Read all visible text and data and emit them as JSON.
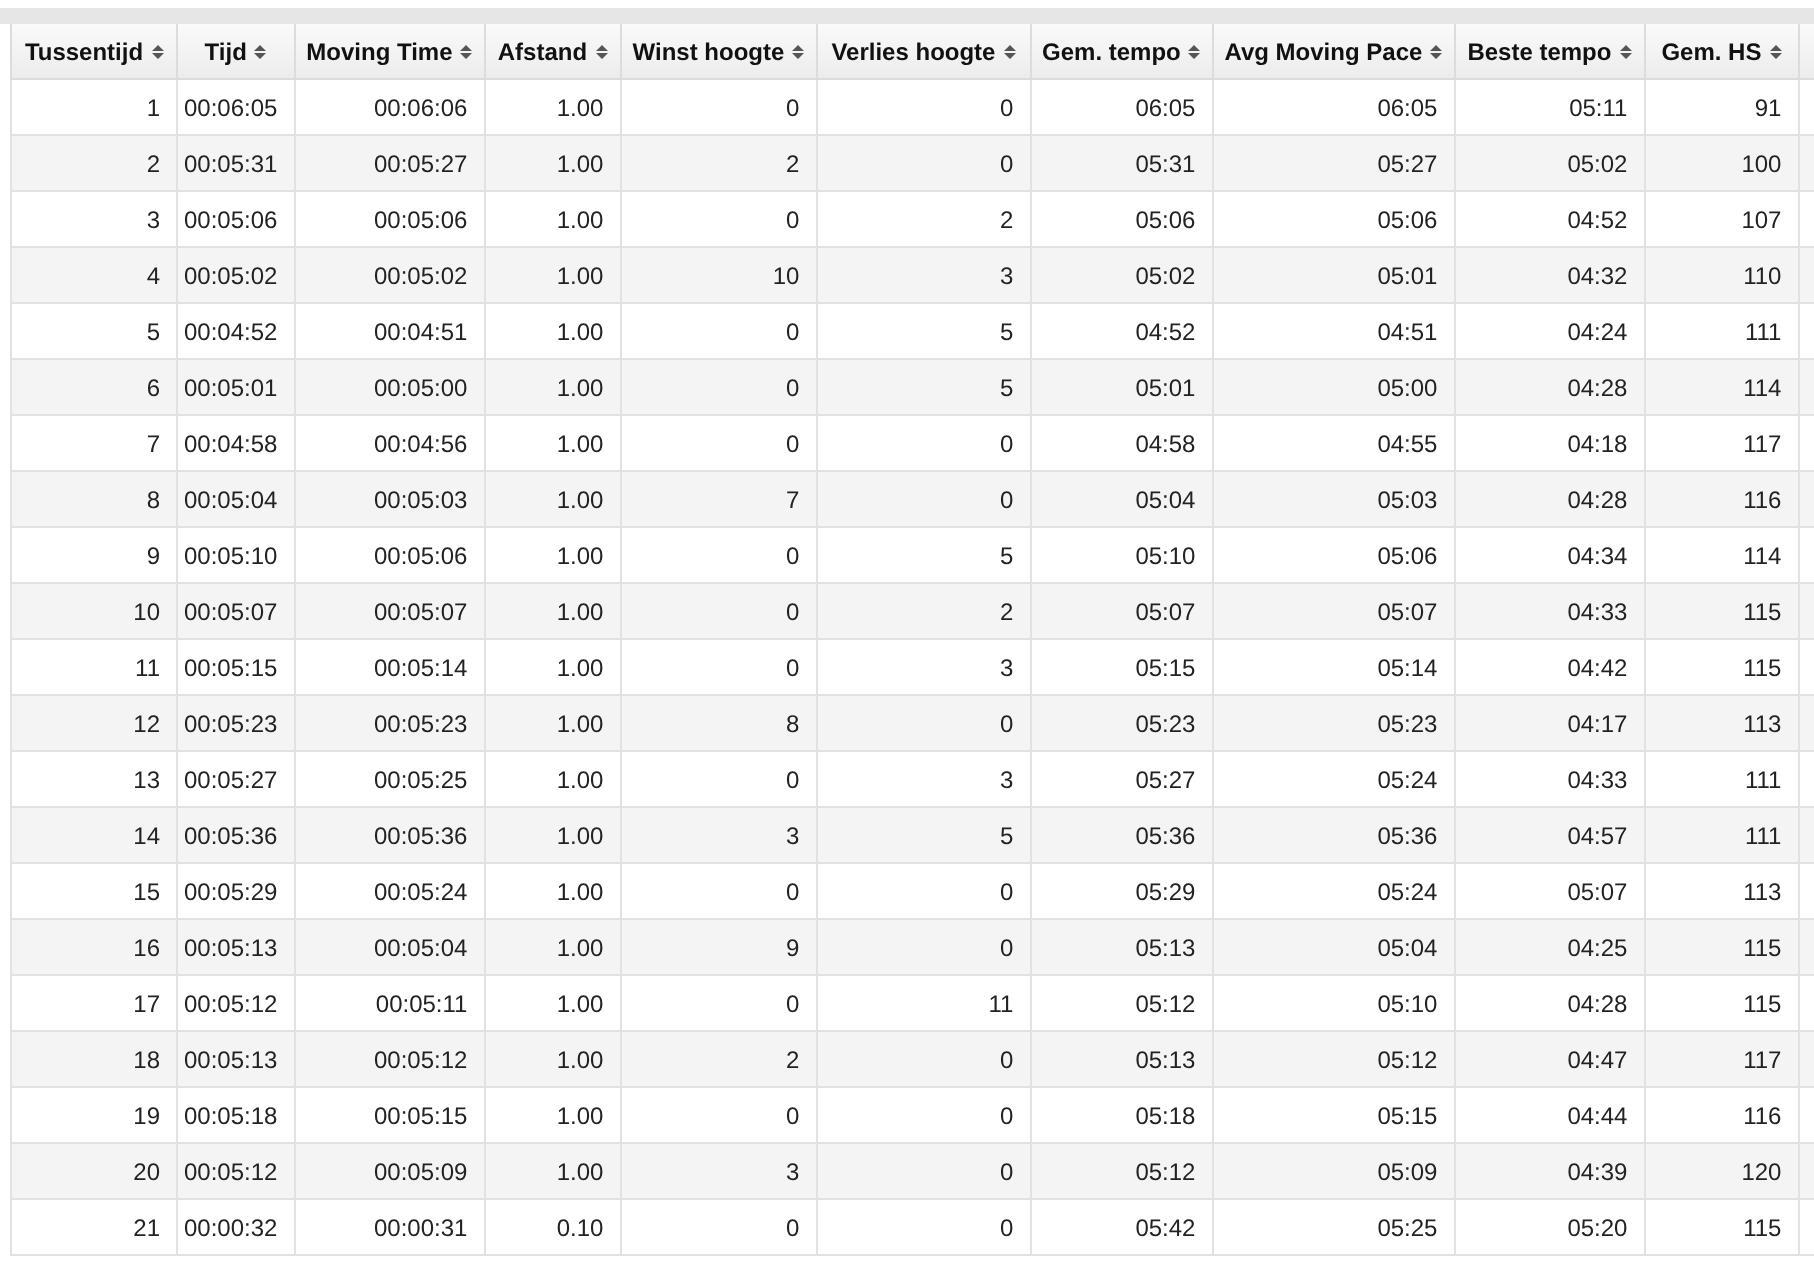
{
  "table": {
    "columns": [
      "Tussentijd",
      "Tijd",
      "Moving Time",
      "Afstand",
      "Winst hoogte",
      "Verlies hoogte",
      "Gem. tempo",
      "Avg Moving Pace",
      "Beste tempo",
      "Gem. HS"
    ],
    "rows": [
      [
        "1",
        "00:06:05",
        "00:06:06",
        "1.00",
        "0",
        "0",
        "06:05",
        "06:05",
        "05:11",
        "91"
      ],
      [
        "2",
        "00:05:31",
        "00:05:27",
        "1.00",
        "2",
        "0",
        "05:31",
        "05:27",
        "05:02",
        "100"
      ],
      [
        "3",
        "00:05:06",
        "00:05:06",
        "1.00",
        "0",
        "2",
        "05:06",
        "05:06",
        "04:52",
        "107"
      ],
      [
        "4",
        "00:05:02",
        "00:05:02",
        "1.00",
        "10",
        "3",
        "05:02",
        "05:01",
        "04:32",
        "110"
      ],
      [
        "5",
        "00:04:52",
        "00:04:51",
        "1.00",
        "0",
        "5",
        "04:52",
        "04:51",
        "04:24",
        "111"
      ],
      [
        "6",
        "00:05:01",
        "00:05:00",
        "1.00",
        "0",
        "5",
        "05:01",
        "05:00",
        "04:28",
        "114"
      ],
      [
        "7",
        "00:04:58",
        "00:04:56",
        "1.00",
        "0",
        "0",
        "04:58",
        "04:55",
        "04:18",
        "117"
      ],
      [
        "8",
        "00:05:04",
        "00:05:03",
        "1.00",
        "7",
        "0",
        "05:04",
        "05:03",
        "04:28",
        "116"
      ],
      [
        "9",
        "00:05:10",
        "00:05:06",
        "1.00",
        "0",
        "5",
        "05:10",
        "05:06",
        "04:34",
        "114"
      ],
      [
        "10",
        "00:05:07",
        "00:05:07",
        "1.00",
        "0",
        "2",
        "05:07",
        "05:07",
        "04:33",
        "115"
      ],
      [
        "11",
        "00:05:15",
        "00:05:14",
        "1.00",
        "0",
        "3",
        "05:15",
        "05:14",
        "04:42",
        "115"
      ],
      [
        "12",
        "00:05:23",
        "00:05:23",
        "1.00",
        "8",
        "0",
        "05:23",
        "05:23",
        "04:17",
        "113"
      ],
      [
        "13",
        "00:05:27",
        "00:05:25",
        "1.00",
        "0",
        "3",
        "05:27",
        "05:24",
        "04:33",
        "111"
      ],
      [
        "14",
        "00:05:36",
        "00:05:36",
        "1.00",
        "3",
        "5",
        "05:36",
        "05:36",
        "04:57",
        "111"
      ],
      [
        "15",
        "00:05:29",
        "00:05:24",
        "1.00",
        "0",
        "0",
        "05:29",
        "05:24",
        "05:07",
        "113"
      ],
      [
        "16",
        "00:05:13",
        "00:05:04",
        "1.00",
        "9",
        "0",
        "05:13",
        "05:04",
        "04:25",
        "115"
      ],
      [
        "17",
        "00:05:12",
        "00:05:11",
        "1.00",
        "0",
        "11",
        "05:12",
        "05:10",
        "04:28",
        "115"
      ],
      [
        "18",
        "00:05:13",
        "00:05:12",
        "1.00",
        "2",
        "0",
        "05:13",
        "05:12",
        "04:47",
        "117"
      ],
      [
        "19",
        "00:05:18",
        "00:05:15",
        "1.00",
        "0",
        "0",
        "05:18",
        "05:15",
        "04:44",
        "116"
      ],
      [
        "20",
        "00:05:12",
        "00:05:09",
        "1.00",
        "3",
        "0",
        "05:12",
        "05:09",
        "04:39",
        "120"
      ],
      [
        "21",
        "00:00:32",
        "00:00:31",
        "0.10",
        "0",
        "0",
        "05:42",
        "05:25",
        "05:20",
        "115"
      ]
    ]
  }
}
